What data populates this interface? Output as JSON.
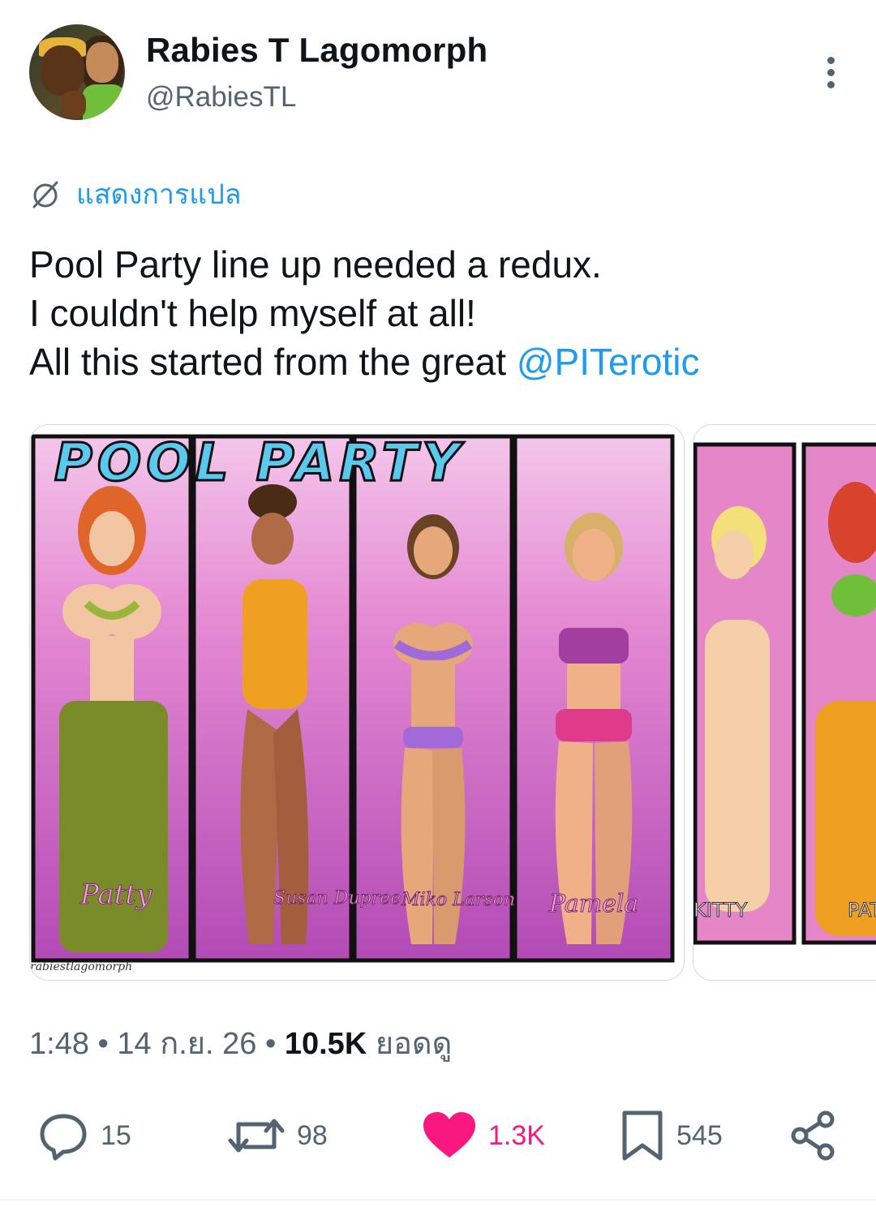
{
  "author": {
    "name": "Rabies T Lagomorph",
    "handle": "@RabiesTL"
  },
  "translate_label": "แสดงการแปล",
  "tweet": {
    "line1": "Pool Party line up needed a redux.",
    "line2": "I couldn't help myself at all!",
    "line3_prefix": "All this started from the great ",
    "mention": "@PITerotic"
  },
  "media": {
    "banner_title": "POOL PARTY",
    "characters": [
      "Patty",
      "Susan Dupree",
      "Miko Larson",
      "Pamela"
    ],
    "watermark": "rabiestlagomorph",
    "second_image_labels": [
      "KITTY",
      "PAT"
    ]
  },
  "meta": {
    "time": "1:48",
    "sep1": " • ",
    "date": "14 ก.ย. 26",
    "sep2": " • ",
    "views": "10.5K",
    "views_label": " ยอดดู"
  },
  "stats": {
    "replies": "15",
    "reposts": "98",
    "likes": "1.3K",
    "bookmarks": "545"
  },
  "colors": {
    "accent": "#1d9bf0",
    "like": "#f91880",
    "muted": "#536471",
    "text": "#0f1419"
  },
  "icons": [
    "more-icon",
    "translate-icon",
    "reply-icon",
    "repost-icon",
    "like-icon",
    "bookmark-icon",
    "share-icon"
  ]
}
